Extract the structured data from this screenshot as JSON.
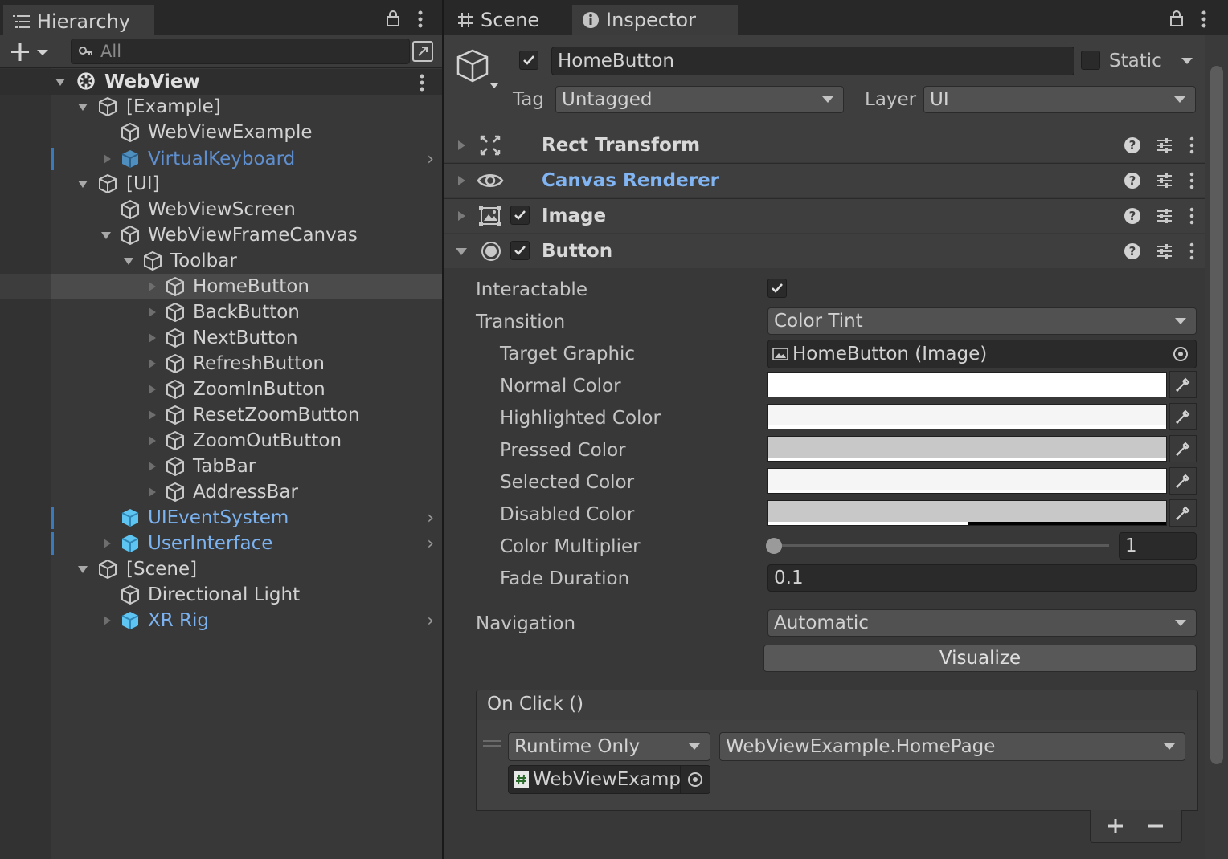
{
  "hierarchy": {
    "tab_title": "Hierarchy",
    "search_placeholder": "All",
    "scene_name": "WebView",
    "items": [
      {
        "label": "[Example]"
      },
      {
        "label": "WebViewExample"
      },
      {
        "label": "VirtualKeyboard"
      },
      {
        "label": "[UI]"
      },
      {
        "label": "WebViewScreen"
      },
      {
        "label": "WebViewFrameCanvas"
      },
      {
        "label": "Toolbar"
      },
      {
        "label": "HomeButton"
      },
      {
        "label": "BackButton"
      },
      {
        "label": "NextButton"
      },
      {
        "label": "RefreshButton"
      },
      {
        "label": "ZoomInButton"
      },
      {
        "label": "ResetZoomButton"
      },
      {
        "label": "ZoomOutButton"
      },
      {
        "label": "TabBar"
      },
      {
        "label": "AddressBar"
      },
      {
        "label": "UIEventSystem"
      },
      {
        "label": "UserInterface"
      },
      {
        "label": "[Scene]"
      },
      {
        "label": "Directional Light"
      },
      {
        "label": "XR Rig"
      }
    ]
  },
  "tabs": {
    "scene": "Scene",
    "inspector": "Inspector"
  },
  "inspector": {
    "object_name": "HomeButton",
    "static_label": "Static",
    "tag_label": "Tag",
    "tag_value": "Untagged",
    "layer_label": "Layer",
    "layer_value": "UI",
    "components": [
      {
        "name": "Rect Transform"
      },
      {
        "name": "Canvas Renderer"
      },
      {
        "name": "Image"
      },
      {
        "name": "Button"
      }
    ],
    "button": {
      "interactable_label": "Interactable",
      "interactable": true,
      "transition_label": "Transition",
      "transition_value": "Color Tint",
      "target_graphic_label": "Target Graphic",
      "target_graphic_value": "HomeButton (Image)",
      "normal_color_label": "Normal Color",
      "normal_color": "#ffffff",
      "highlighted_color_label": "Highlighted Color",
      "highlighted_color": "#f5f5f5",
      "pressed_color_label": "Pressed Color",
      "pressed_color": "#c8c8c8",
      "selected_color_label": "Selected Color",
      "selected_color": "#f5f5f5",
      "disabled_color_label": "Disabled Color",
      "disabled_color": "#c8c8c8",
      "disabled_alpha": 0.5,
      "color_multiplier_label": "Color Multiplier",
      "color_multiplier": "1",
      "fade_duration_label": "Fade Duration",
      "fade_duration": "0.1",
      "navigation_label": "Navigation",
      "navigation_value": "Automatic",
      "visualize_label": "Visualize",
      "onclick_label": "On Click ()",
      "runtime_value": "Runtime Only",
      "function_value": "WebViewExample.HomePage",
      "object_value": "WebViewExampl"
    }
  },
  "colors": {
    "panel": "#383838",
    "accent_blue": "#7bb2f0",
    "prefab_blue": "#5ec4f2"
  }
}
